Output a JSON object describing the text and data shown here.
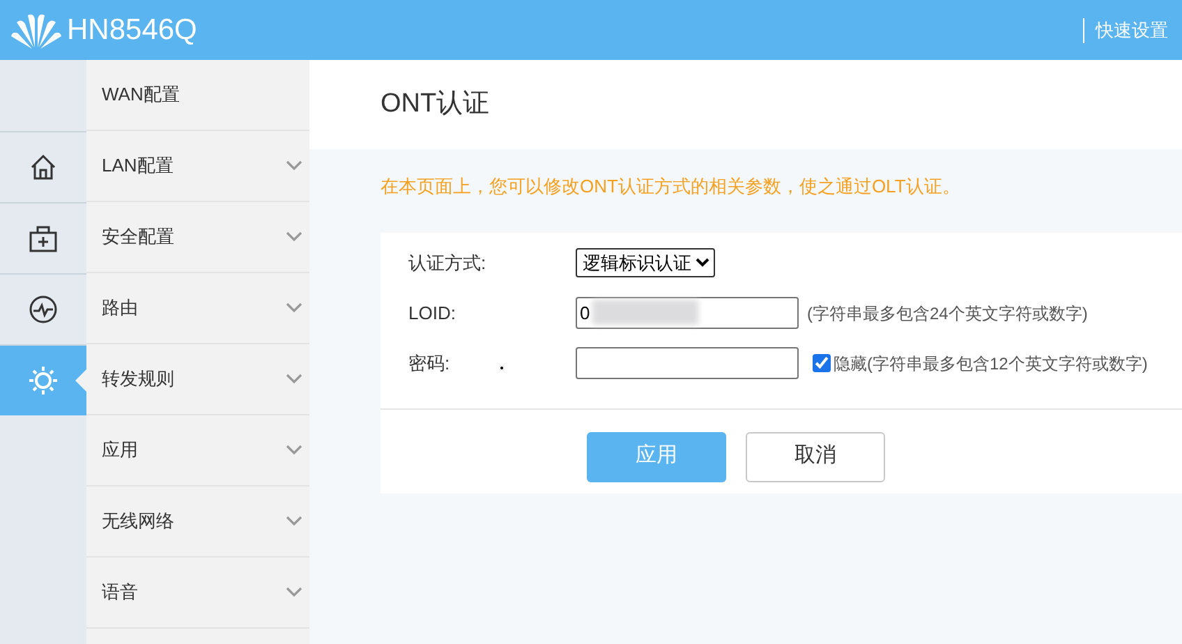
{
  "header": {
    "title": "HN8546Q",
    "quick_setup": "快速设置"
  },
  "icon_bar": [
    {
      "kind": "home",
      "selected": false
    },
    {
      "kind": "kit",
      "selected": false
    },
    {
      "kind": "pulse",
      "selected": false
    },
    {
      "kind": "gear",
      "selected": true
    }
  ],
  "menu": [
    {
      "label": "WAN配置",
      "expandable": false
    },
    {
      "label": "LAN配置",
      "expandable": true
    },
    {
      "label": "安全配置",
      "expandable": true
    },
    {
      "label": "路由",
      "expandable": true
    },
    {
      "label": "转发规则",
      "expandable": true
    },
    {
      "label": "应用",
      "expandable": true
    },
    {
      "label": "无线网络",
      "expandable": true
    },
    {
      "label": "语音",
      "expandable": true
    }
  ],
  "page": {
    "title": "ONT认证",
    "notice": "在本页面上，您可以修改ONT认证方式的相关参数，使之通过OLT认证。"
  },
  "form": {
    "auth_mode": {
      "label": "认证方式:",
      "value": "逻辑标识认证"
    },
    "loid": {
      "label": "LOID:",
      "value": "0",
      "hint": "(字符串最多包含24个英文字符或数字)"
    },
    "password": {
      "label": "密码:",
      "hide_label": "隐藏(字符串最多包含12个英文字符或数字)",
      "hide_checked": true
    }
  },
  "buttons": [
    {
      "label": "应用",
      "kind": "primary"
    },
    {
      "label": "取消",
      "kind": "secondary"
    }
  ]
}
